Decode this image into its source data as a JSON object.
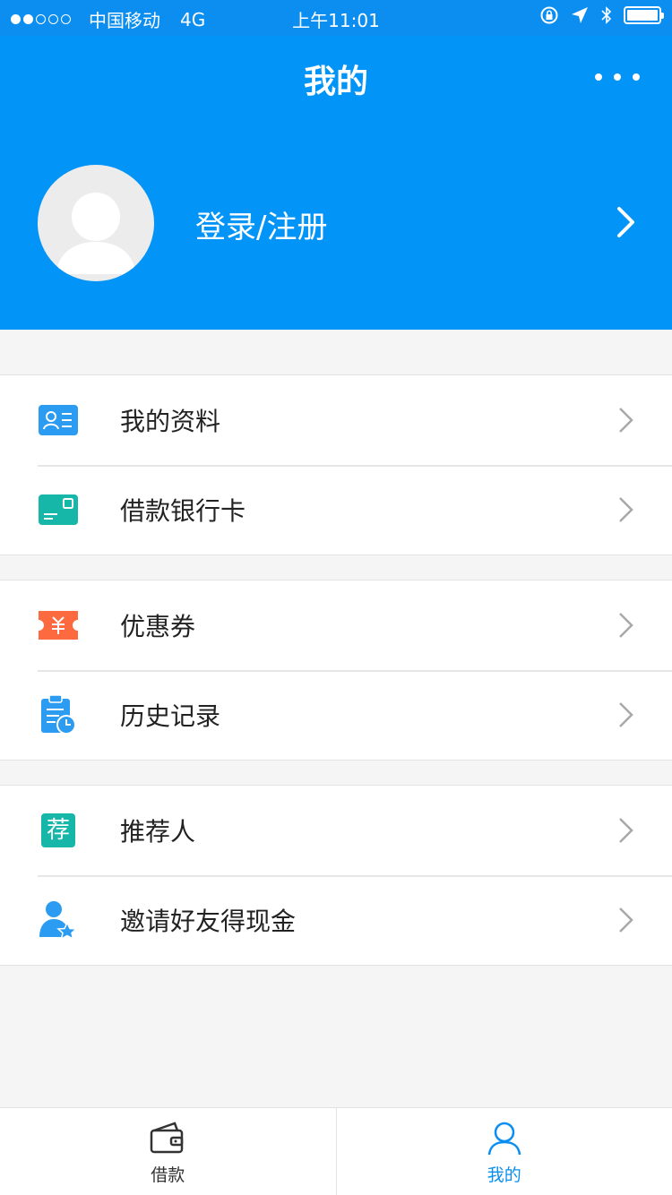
{
  "status": {
    "carrier": "中国移动",
    "network": "4G",
    "time": "上午11:01"
  },
  "header": {
    "title": "我的",
    "login_label": "登录/注册"
  },
  "menu_groups": [
    [
      {
        "label": "我的资料",
        "icon": "profile-card-icon",
        "color": "#2b9cf2"
      },
      {
        "label": "借款银行卡",
        "icon": "bank-card-icon",
        "color": "#16b6a8"
      }
    ],
    [
      {
        "label": "优惠券",
        "icon": "coupon-icon",
        "color": "#fd6a3f"
      },
      {
        "label": "历史记录",
        "icon": "history-icon",
        "color": "#2b9cf2"
      }
    ],
    [
      {
        "label": "推荐人",
        "icon": "referrer-icon",
        "color": "#16b6a8",
        "glyph": "荐"
      },
      {
        "label": "邀请好友得现金",
        "icon": "invite-friend-icon",
        "color": "#2b9cf2"
      }
    ]
  ],
  "tabbar": {
    "loan_label": "借款",
    "mine_label": "我的"
  },
  "colors": {
    "header": "#0394f7",
    "accent": "#0a8ff0"
  }
}
